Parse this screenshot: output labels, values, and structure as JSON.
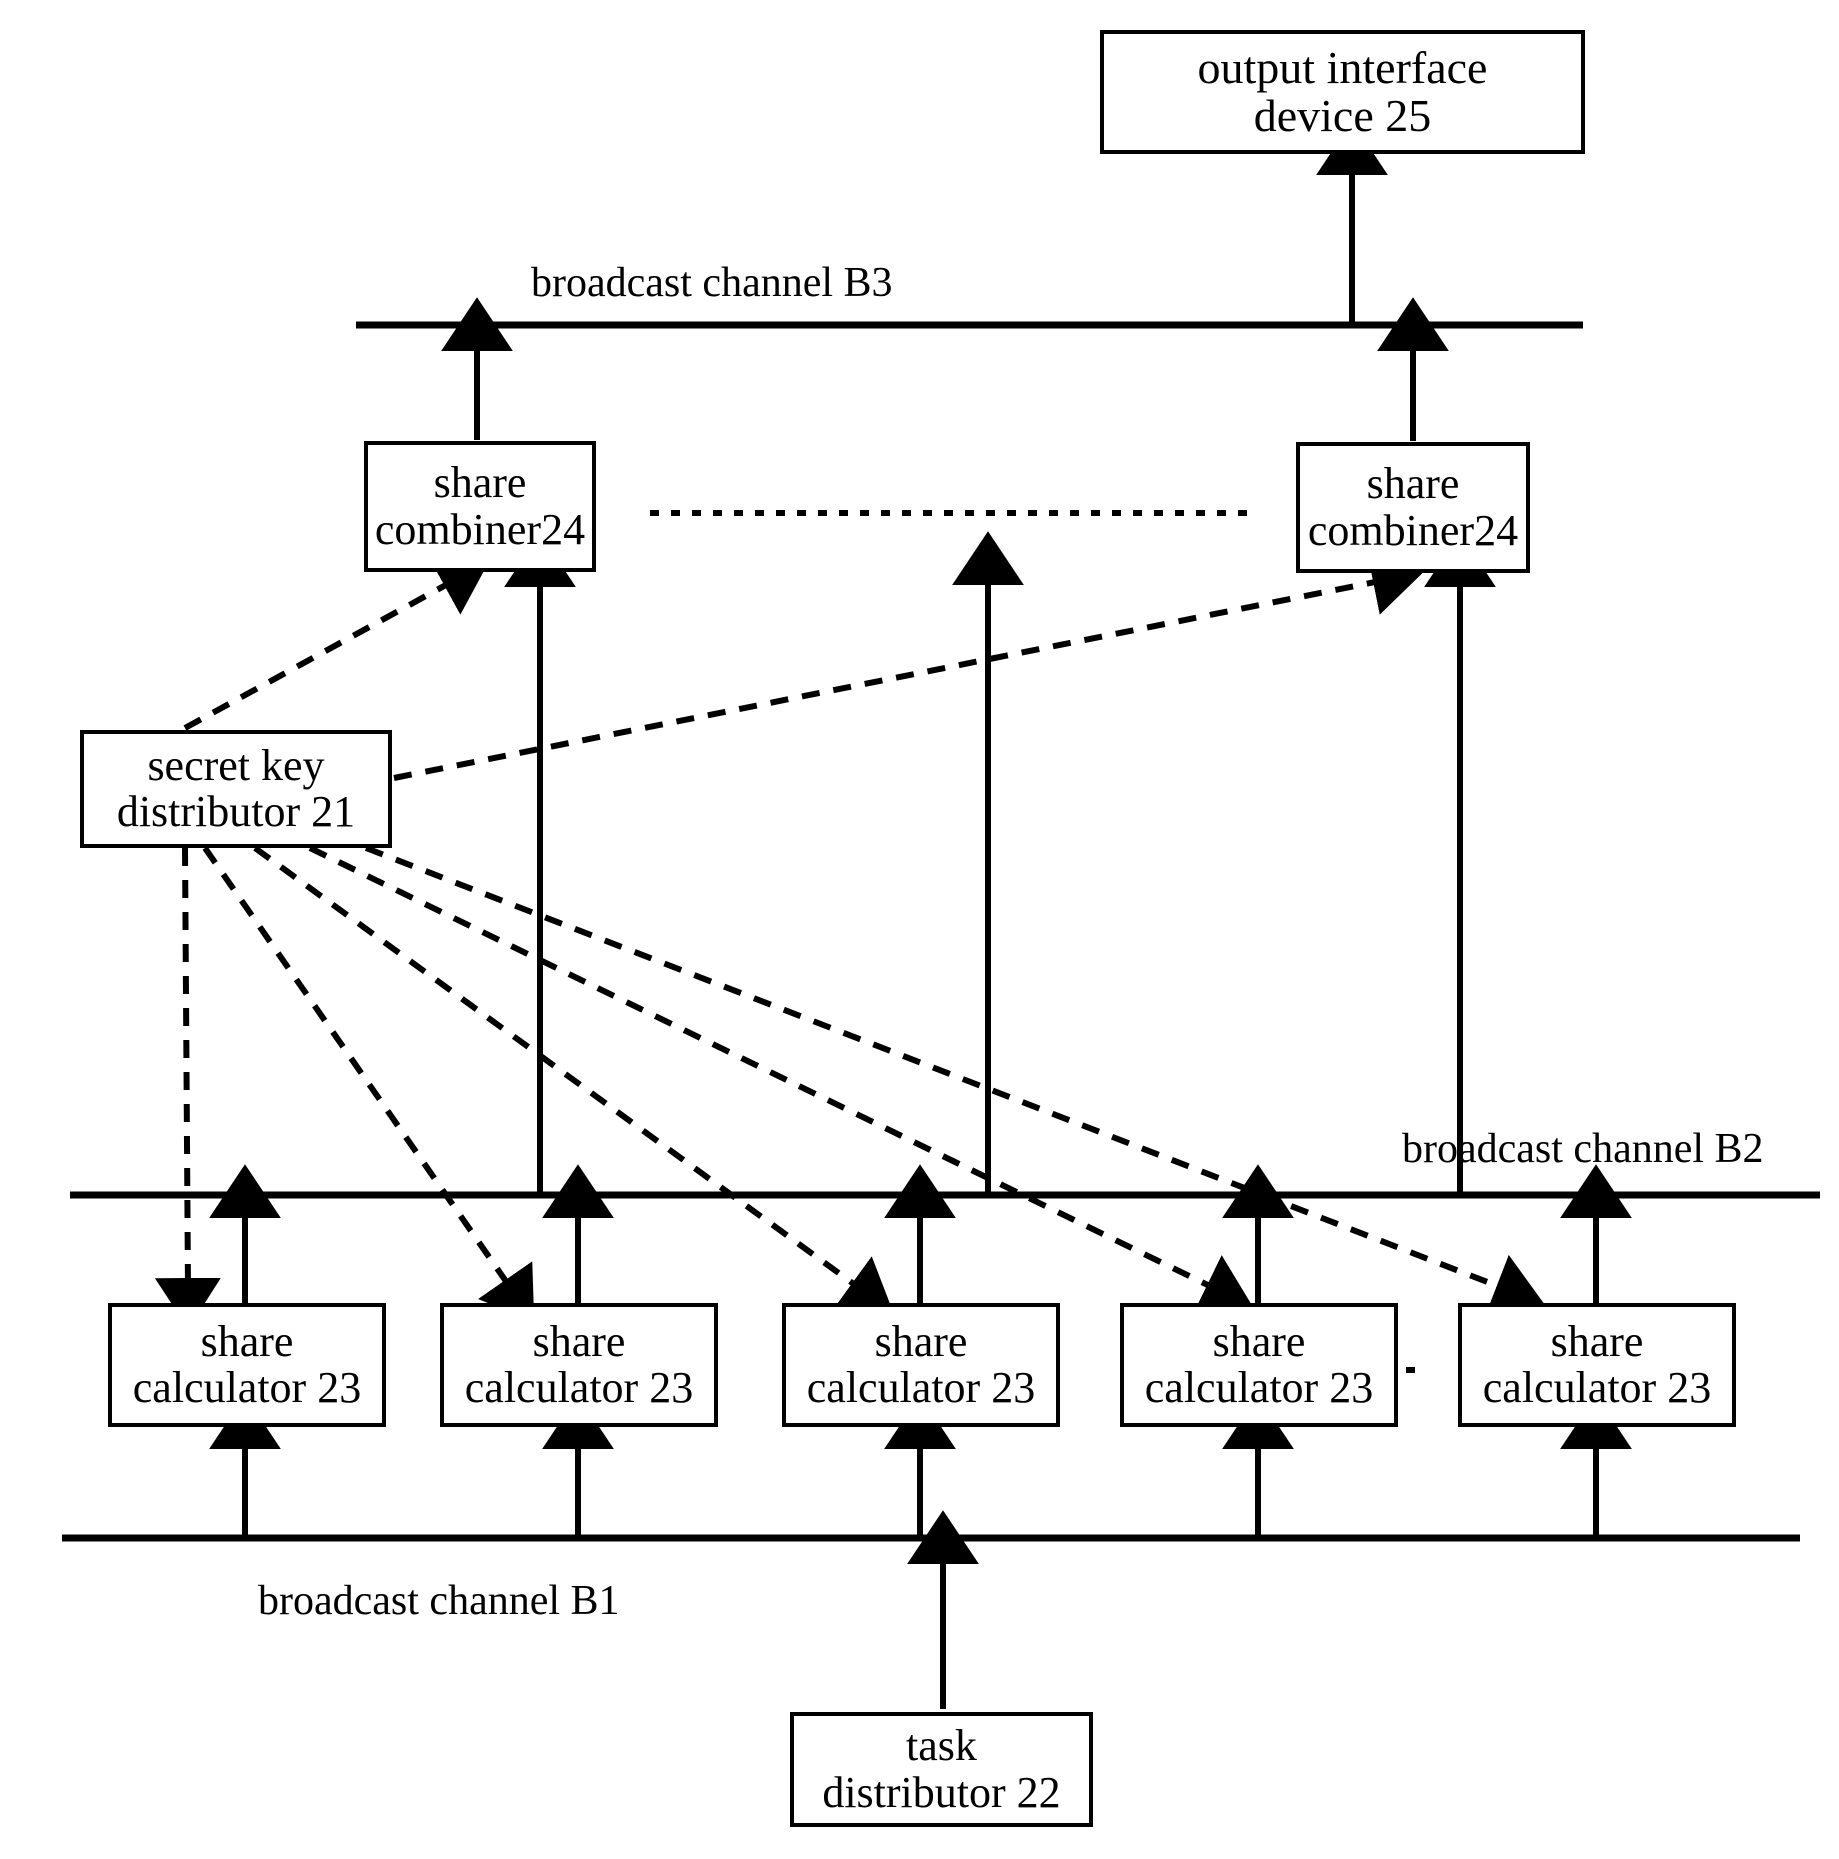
{
  "figure": {
    "title": "secure multiparty computation system block diagram",
    "stroke_color": "#000000",
    "background_color": "#ffffff"
  },
  "nodes": {
    "output_interface": {
      "line1": "output interface",
      "line2": "device 25"
    },
    "share_combiner_left": {
      "line1": "share",
      "line2": "combiner24"
    },
    "share_combiner_right": {
      "line1": "share",
      "line2": "combiner24"
    },
    "secret_key_distributor": {
      "line1": "secret key",
      "line2": "distributor 21"
    },
    "task_distributor": {
      "line1": "task",
      "line2": "distributor 22"
    },
    "share_calculators": [
      {
        "line1": "share",
        "line2": "calculator 23"
      },
      {
        "line1": "share",
        "line2": "calculator 23"
      },
      {
        "line1": "share",
        "line2": "calculator 23"
      },
      {
        "line1": "share",
        "line2": "calculator 23"
      },
      {
        "line1": "share",
        "line2": "calculator 23"
      }
    ]
  },
  "channels": {
    "b3_label": "broadcast channel B3",
    "b2_label": "broadcast channel B2",
    "b1_label": "broadcast channel B1"
  }
}
